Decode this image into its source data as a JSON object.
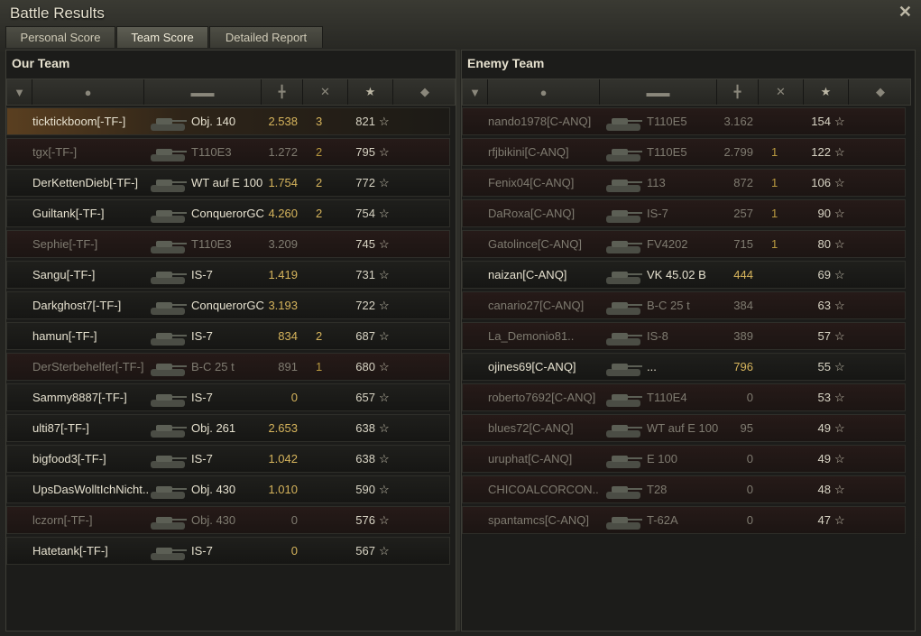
{
  "window": {
    "title": "Battle Results"
  },
  "tabs": [
    {
      "label": "Personal Score",
      "active": false
    },
    {
      "label": "Team Score",
      "active": true
    },
    {
      "label": "Detailed Report",
      "active": false
    }
  ],
  "our_team": {
    "title": "Our Team",
    "rows": [
      {
        "name": "ticktickboom[-TF-]",
        "tank": "Obj. 140",
        "damage": "2.538",
        "frags": "3",
        "xp": "821",
        "state": "player"
      },
      {
        "name": "tgx[-TF-]",
        "tank": "T110E3",
        "damage": "1.272",
        "frags": "2",
        "xp": "795",
        "state": "dead"
      },
      {
        "name": "DerKettenDieb[-TF-]",
        "tank": "WT auf E 100",
        "damage": "1.754",
        "frags": "2",
        "xp": "772",
        "state": "alive"
      },
      {
        "name": "Guiltank[-TF-]",
        "tank": "ConquerorGC",
        "damage": "4.260",
        "frags": "2",
        "xp": "754",
        "state": "alive"
      },
      {
        "name": "Sephie[-TF-]",
        "tank": "T110E3",
        "damage": "3.209",
        "frags": "",
        "xp": "745",
        "state": "dead"
      },
      {
        "name": "Sangu[-TF-]",
        "tank": "IS-7",
        "damage": "1.419",
        "frags": "",
        "xp": "731",
        "state": "alive"
      },
      {
        "name": "Darkghost7[-TF-]",
        "tank": "ConquerorGC",
        "damage": "3.193",
        "frags": "",
        "xp": "722",
        "state": "alive"
      },
      {
        "name": "hamun[-TF-]",
        "tank": "IS-7",
        "damage": "834",
        "frags": "2",
        "xp": "687",
        "state": "alive"
      },
      {
        "name": "DerSterbehelfer[-TF-]",
        "tank": "B-C 25 t",
        "damage": "891",
        "frags": "1",
        "xp": "680",
        "state": "dead"
      },
      {
        "name": "Sammy8887[-TF-]",
        "tank": "IS-7",
        "damage": "0",
        "frags": "",
        "xp": "657",
        "state": "alive"
      },
      {
        "name": "ulti87[-TF-]",
        "tank": "Obj. 261",
        "damage": "2.653",
        "frags": "",
        "xp": "638",
        "state": "alive"
      },
      {
        "name": "bigfood3[-TF-]",
        "tank": "IS-7",
        "damage": "1.042",
        "frags": "",
        "xp": "638",
        "state": "alive"
      },
      {
        "name": "UpsDasWolltIchNicht..",
        "tank": "Obj. 430",
        "damage": "1.010",
        "frags": "",
        "xp": "590",
        "state": "alive"
      },
      {
        "name": "lczorn[-TF-]",
        "tank": "Obj. 430",
        "damage": "0",
        "frags": "",
        "xp": "576",
        "state": "dead"
      },
      {
        "name": "Hatetank[-TF-]",
        "tank": "IS-7",
        "damage": "0",
        "frags": "",
        "xp": "567",
        "state": "alive"
      }
    ]
  },
  "enemy_team": {
    "title": "Enemy Team",
    "rows": [
      {
        "name": "nando1978[C-ANQ]",
        "tank": "T110E5",
        "damage": "3.162",
        "frags": "",
        "xp": "154",
        "state": "dead"
      },
      {
        "name": "rfjbikini[C-ANQ]",
        "tank": "T110E5",
        "damage": "2.799",
        "frags": "1",
        "xp": "122",
        "state": "dead"
      },
      {
        "name": "Fenix04[C-ANQ]",
        "tank": "113",
        "damage": "872",
        "frags": "1",
        "xp": "106",
        "state": "dead"
      },
      {
        "name": "DaRoxa[C-ANQ]",
        "tank": "IS-7",
        "damage": "257",
        "frags": "1",
        "xp": "90",
        "state": "dead"
      },
      {
        "name": "Gatolince[C-ANQ]",
        "tank": "FV4202",
        "damage": "715",
        "frags": "1",
        "xp": "80",
        "state": "dead"
      },
      {
        "name": "naizan[C-ANQ]",
        "tank": "VK 45.02 B",
        "damage": "444",
        "frags": "",
        "xp": "69",
        "state": "alive"
      },
      {
        "name": "canario27[C-ANQ]",
        "tank": "B-C 25 t",
        "damage": "384",
        "frags": "",
        "xp": "63",
        "state": "dead"
      },
      {
        "name": "La_Demonio81..",
        "tank": "IS-8",
        "damage": "389",
        "frags": "",
        "xp": "57",
        "state": "dead"
      },
      {
        "name": "ojines69[C-ANQ]",
        "tank": "...",
        "damage": "796",
        "frags": "",
        "xp": "55",
        "state": "alive"
      },
      {
        "name": "roberto7692[C-ANQ]",
        "tank": "T110E4",
        "damage": "0",
        "frags": "",
        "xp": "53",
        "state": "dead"
      },
      {
        "name": "blues72[C-ANQ]",
        "tank": "WT auf E 100",
        "damage": "95",
        "frags": "",
        "xp": "49",
        "state": "dead"
      },
      {
        "name": "uruphat[C-ANQ]",
        "tank": "E 100",
        "damage": "0",
        "frags": "",
        "xp": "49",
        "state": "dead"
      },
      {
        "name": "CHICOALCORCON..",
        "tank": "T28",
        "damage": "0",
        "frags": "",
        "xp": "48",
        "state": "dead"
      },
      {
        "name": "spantamcs[C-ANQ]",
        "tank": "T-62A",
        "damage": "0",
        "frags": "",
        "xp": "47",
        "state": "dead"
      }
    ]
  },
  "icons": {
    "close": "close-icon",
    "columns": [
      "squad-icon",
      "player-icon",
      "tank-icon",
      "damage-icon",
      "frags-icon",
      "xp-star-icon",
      "medal-icon"
    ],
    "xp_star": "☆",
    "unknown_tank": "?"
  },
  "colors": {
    "damage": "#d6b45c",
    "player_highlight": "#5a3f20"
  }
}
